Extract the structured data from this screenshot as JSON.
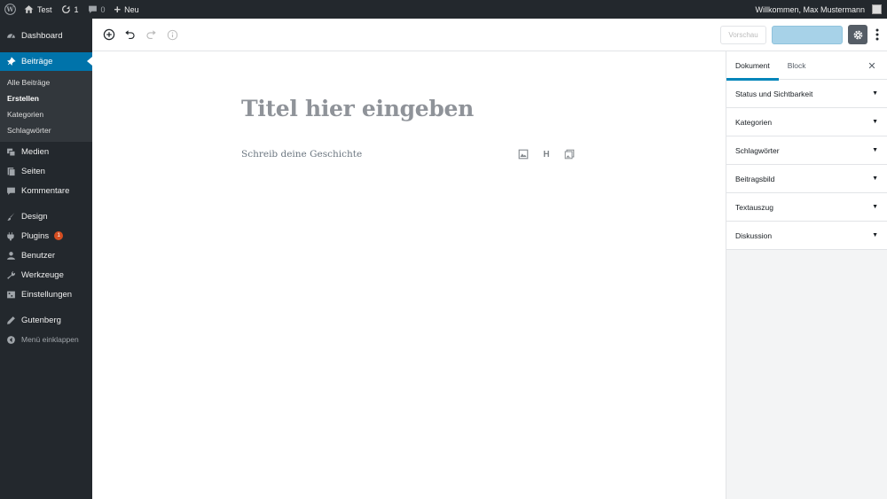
{
  "adminbar": {
    "site_name": "Test",
    "updates_count": "1",
    "comments_count": "0",
    "new_label": "Neu",
    "greeting": "Willkommen, Max Mustermann"
  },
  "sidebar": {
    "items": [
      {
        "label": "Dashboard",
        "icon": "dashboard-icon"
      },
      {
        "label": "Beiträge",
        "icon": "pin-icon"
      },
      {
        "label": "Medien",
        "icon": "media-icon"
      },
      {
        "label": "Seiten",
        "icon": "pages-icon"
      },
      {
        "label": "Kommentare",
        "icon": "comments-icon"
      },
      {
        "label": "Design",
        "icon": "brush-icon"
      },
      {
        "label": "Plugins",
        "icon": "plugin-icon",
        "badge": "1"
      },
      {
        "label": "Benutzer",
        "icon": "user-icon"
      },
      {
        "label": "Werkzeuge",
        "icon": "wrench-icon"
      },
      {
        "label": "Einstellungen",
        "icon": "settings-icon"
      },
      {
        "label": "Gutenberg",
        "icon": "pencil-icon"
      }
    ],
    "submenu": [
      "Alle Beiträge",
      "Erstellen",
      "Kategorien",
      "Schlagwörter"
    ],
    "collapse_label": "Menü einklappen"
  },
  "toolbar": {
    "preview_label": "Vorschau"
  },
  "editor": {
    "title_placeholder": "Titel hier eingeben",
    "body_placeholder": "Schreib deine Geschichte",
    "heading_inserter": "H"
  },
  "settings": {
    "tabs": [
      "Dokument",
      "Block"
    ],
    "close_label": "✕",
    "sections": [
      "Status und Sichtbarkeit",
      "Kategorien",
      "Schlagwörter",
      "Beitragsbild",
      "Textauszug",
      "Diskussion"
    ]
  },
  "colors": {
    "admin_dark": "#23282d",
    "accent_blue": "#0073aa",
    "publish_disabled": "#a7d2e8",
    "badge_orange": "#d54e21"
  }
}
